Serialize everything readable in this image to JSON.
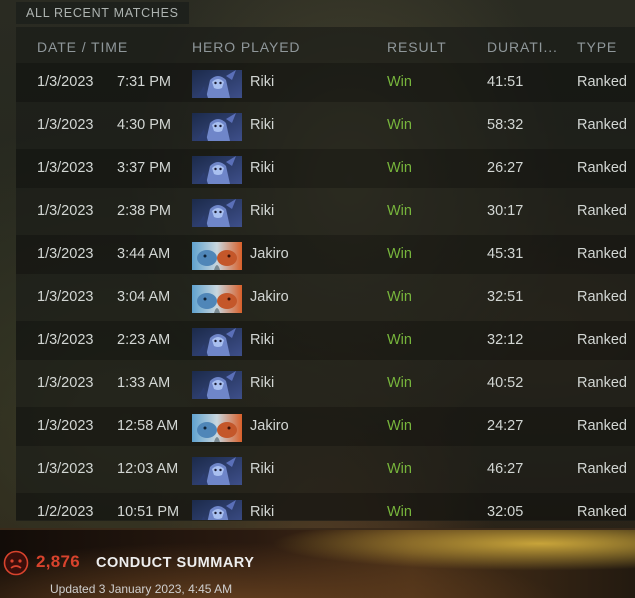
{
  "panel": {
    "title": "ALL RECENT MATCHES"
  },
  "columns": {
    "date": "DATE / TIME",
    "hero": "HERO PLAYED",
    "result": "RESULT",
    "duration": "DURATI...",
    "type": "TYPE"
  },
  "matches": [
    {
      "date": "1/3/2023",
      "time": "7:31 PM",
      "hero_icon": "riki-portrait",
      "hero": "Riki",
      "result": "Win",
      "duration": "41:51",
      "type": "Ranked"
    },
    {
      "date": "1/3/2023",
      "time": "4:30 PM",
      "hero_icon": "riki-portrait",
      "hero": "Riki",
      "result": "Win",
      "duration": "58:32",
      "type": "Ranked"
    },
    {
      "date": "1/3/2023",
      "time": "3:37 PM",
      "hero_icon": "riki-portrait",
      "hero": "Riki",
      "result": "Win",
      "duration": "26:27",
      "type": "Ranked"
    },
    {
      "date": "1/3/2023",
      "time": "2:38 PM",
      "hero_icon": "riki-portrait",
      "hero": "Riki",
      "result": "Win",
      "duration": "30:17",
      "type": "Ranked"
    },
    {
      "date": "1/3/2023",
      "time": "3:44 AM",
      "hero_icon": "jakiro-portrait",
      "hero": "Jakiro",
      "result": "Win",
      "duration": "45:31",
      "type": "Ranked"
    },
    {
      "date": "1/3/2023",
      "time": "3:04 AM",
      "hero_icon": "jakiro-portrait",
      "hero": "Jakiro",
      "result": "Win",
      "duration": "32:51",
      "type": "Ranked"
    },
    {
      "date": "1/3/2023",
      "time": "2:23 AM",
      "hero_icon": "riki-portrait",
      "hero": "Riki",
      "result": "Win",
      "duration": "32:12",
      "type": "Ranked"
    },
    {
      "date": "1/3/2023",
      "time": "1:33 AM",
      "hero_icon": "riki-portrait",
      "hero": "Riki",
      "result": "Win",
      "duration": "40:52",
      "type": "Ranked"
    },
    {
      "date": "1/3/2023",
      "time": "12:58 AM",
      "hero_icon": "jakiro-portrait",
      "hero": "Jakiro",
      "result": "Win",
      "duration": "24:27",
      "type": "Ranked"
    },
    {
      "date": "1/3/2023",
      "time": "12:03 AM",
      "hero_icon": "riki-portrait",
      "hero": "Riki",
      "result": "Win",
      "duration": "46:27",
      "type": "Ranked"
    },
    {
      "date": "1/2/2023",
      "time": "10:51 PM",
      "hero_icon": "riki-portrait",
      "hero": "Riki",
      "result": "Win",
      "duration": "32:05",
      "type": "Ranked"
    }
  ],
  "conduct": {
    "icon": "conduct-face-icon",
    "score": "2,876",
    "title": "CONDUCT SUMMARY",
    "updated": "Updated 3 January 2023, 4:45 AM"
  },
  "colors": {
    "win": "#77b53c",
    "score": "#d8432d",
    "header_text": "#8f979a"
  }
}
